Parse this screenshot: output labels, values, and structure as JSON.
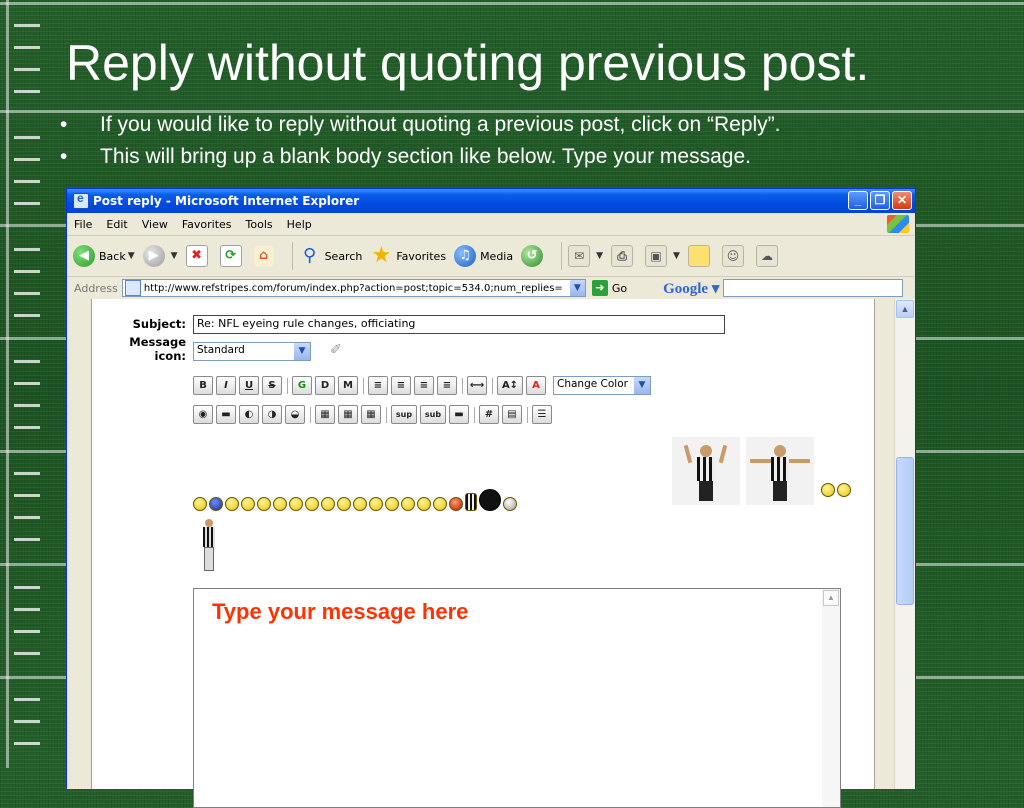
{
  "slide": {
    "title": "Reply without quoting previous post.",
    "bullets": [
      "If you would like to reply without quoting a previous post, click on “Reply”.",
      "This will bring up a blank body section like below.  Type your message."
    ],
    "bullet_glyph": "•"
  },
  "window": {
    "title": "Post reply - Microsoft Internet Explorer",
    "controls": {
      "minimize": "_",
      "restore": "❐",
      "close": "✕"
    }
  },
  "menu": [
    "File",
    "Edit",
    "View",
    "Favorites",
    "Tools",
    "Help"
  ],
  "toolbar": {
    "back_label": "Back",
    "search_label": "Search",
    "favorites_label": "Favorites",
    "media_label": "Media"
  },
  "address": {
    "label": "Address",
    "url": "http://www.refstripes.com/forum/index.php?action=post;topic=534.0;num_replies=",
    "go_label": "Go",
    "google_label": "Google ▾"
  },
  "form": {
    "subject_label": "Subject:",
    "subject_value": "Re: NFL eyeing rule changes, officiating",
    "message_icon_label_1": "Message",
    "message_icon_label_2": "icon:",
    "message_icon_value": "Standard",
    "format_buttons_row1": [
      "B",
      "I",
      "U",
      "S",
      "G",
      "D",
      "M",
      "≡",
      "≡",
      "≡",
      "≡",
      "⟷",
      "A↕",
      "A"
    ],
    "color_select": "Change Color",
    "format_buttons_row2": [
      "◉",
      "▬",
      "◐",
      "◑",
      "◒",
      "▦",
      "▦",
      "▦",
      "sup",
      "sub",
      "▬",
      "#",
      "▤",
      "☰"
    ],
    "message_placeholder": "Type your message here"
  },
  "colors": {
    "accent_title": "#0a5ce8",
    "placeholder_red": "#ff3300",
    "field_green": "#1e5a26"
  }
}
